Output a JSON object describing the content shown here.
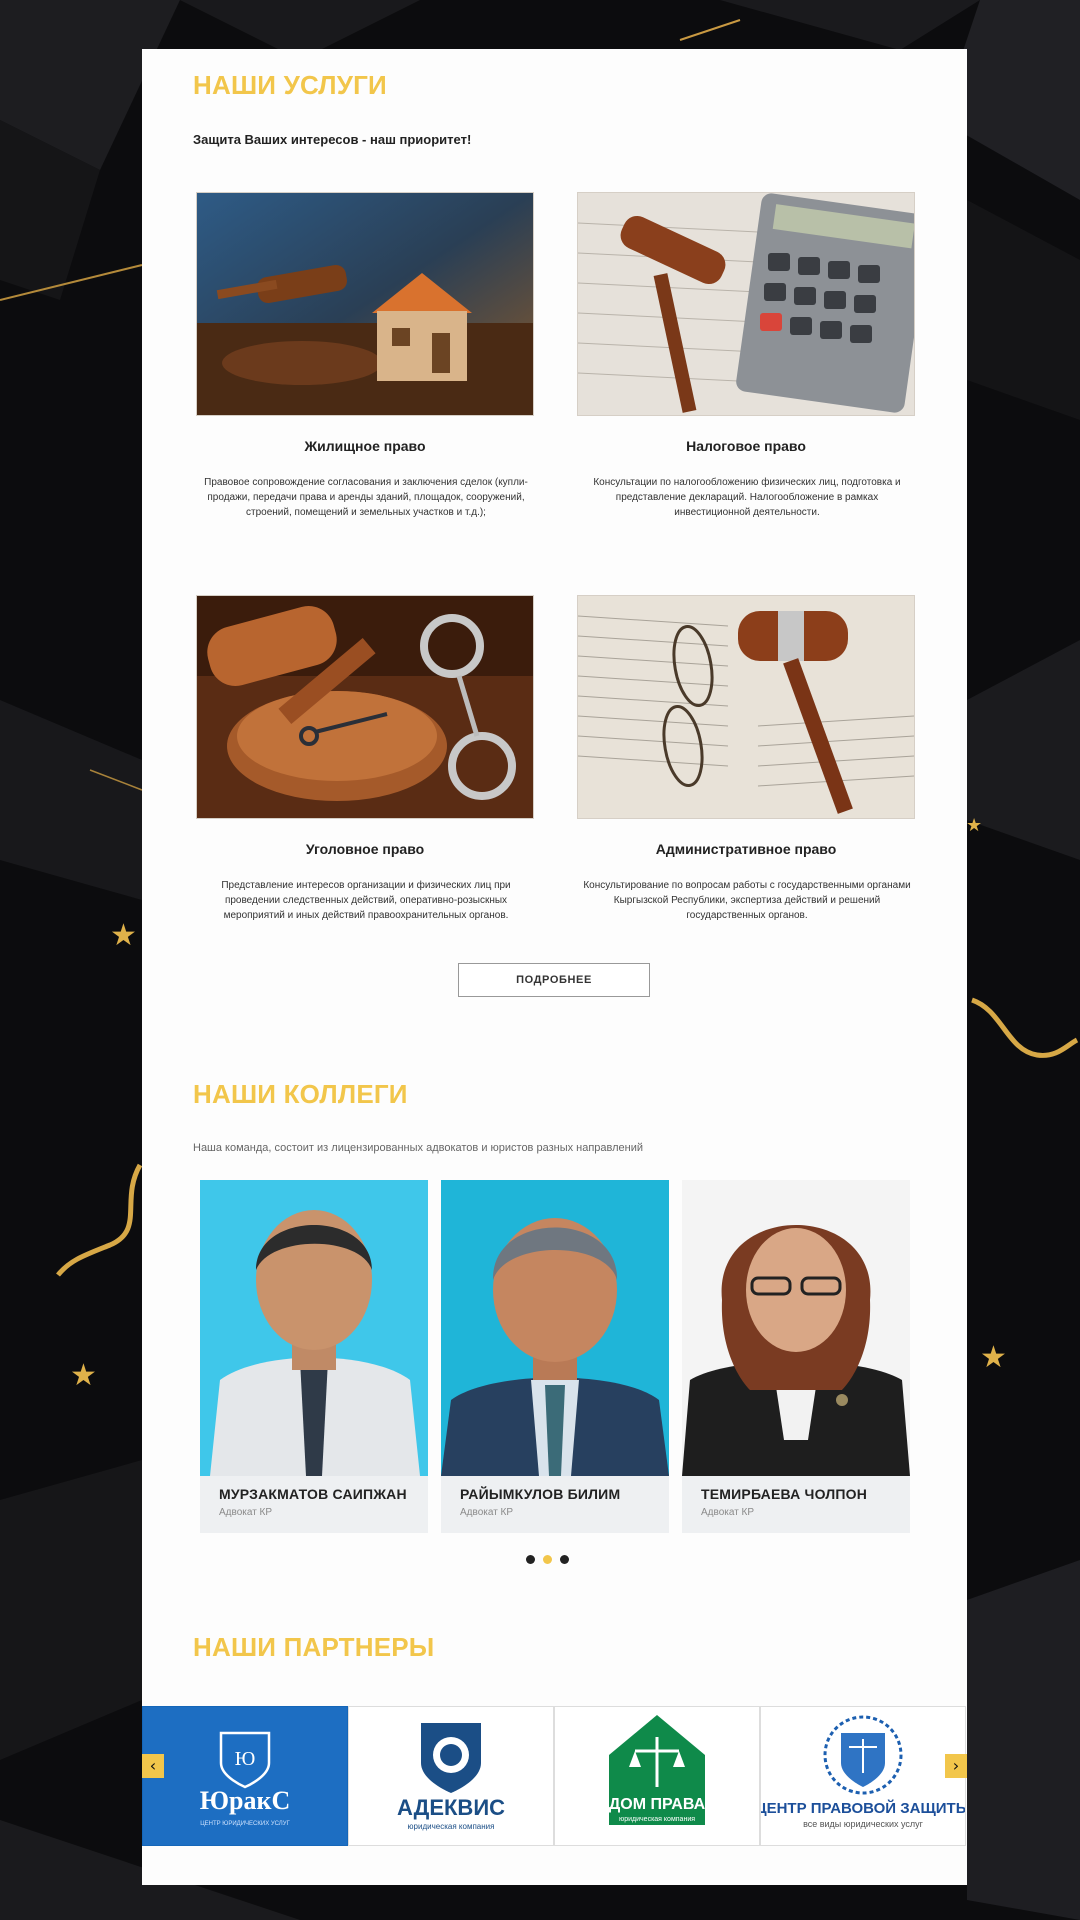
{
  "services": {
    "title": "НАШИ УСЛУГИ",
    "subtitle": "Защита Ваших интересов - наш приоритет!",
    "items": [
      {
        "title": "Жилищное право",
        "text": "Правовое сопровождение согласования и заключения сделок (купли-продажи, передачи права и аренды зданий, площадок, сооружений, строений, помещений и земельных участков и т.д.);"
      },
      {
        "title": "Налоговое право",
        "text": "Консультации по налогообложению физических лиц, подготовка и представление деклараций. Налогообложение в рамках инвестиционной деятельности."
      },
      {
        "title": "Уголовное право",
        "text": "Представление интересов организации и физических лиц при проведении следственных действий, оперативно-розыскных мероприятий и иных действий правоохранительных органов."
      },
      {
        "title": "Административное право",
        "text": "Консультирование по вопросам работы с государственными органами Кыргызской Республики, экспертиза действий и решений государственных органов."
      }
    ],
    "more_label": "ПОДРОБНЕЕ"
  },
  "colleagues": {
    "title": "НАШИ КОЛЛЕГИ",
    "description": "Наша команда, состоит из лицензированных адвокатов и юристов разных направлений",
    "people": [
      {
        "name": "МУРЗАКМАТОВ САИПЖАН",
        "role": "Адвокат КР"
      },
      {
        "name": "РАЙЫМКУЛОВ БИЛИМ",
        "role": "Адвокат КР"
      },
      {
        "name": "ТЕМИРБАЕВА ЧОЛПОН",
        "role": "Адвокат КР"
      }
    ],
    "active_dot": 2
  },
  "partners": {
    "title": "НАШИ ПАРТНЕРЫ",
    "items": [
      {
        "logo_mark": "Ю",
        "name": "ЮракС",
        "tagline": "ЦЕНТР ЮРИДИЧЕСКИХ УСЛУГ"
      },
      {
        "name": "АДЕКВИС",
        "tagline": "юридическая компания"
      },
      {
        "name": "ДОМ ПРАВА",
        "tagline": "юридическая компания"
      },
      {
        "name": "ЦЕНТР ПРАВОВОЙ ЗАЩИТЫ",
        "tagline": "все виды юридических услуг"
      }
    ]
  },
  "colors": {
    "accent": "#f2c64b",
    "background": "#0c0c0e",
    "panel": "#fdfdfd"
  },
  "icons": {
    "prev": "chevron-left-icon",
    "next": "chevron-right-icon"
  }
}
